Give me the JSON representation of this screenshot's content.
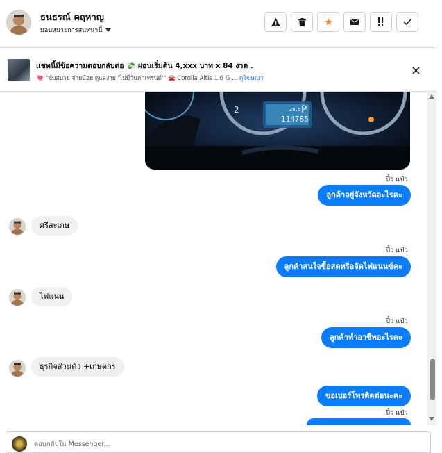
{
  "header": {
    "contact_name": "ธนธรณ์ คฤหาญ",
    "assign_label": "มอบหมายการสนทนานี้",
    "actions": [
      {
        "name": "report-button",
        "icon": "warning-icon"
      },
      {
        "name": "delete-button",
        "icon": "trash-icon"
      },
      {
        "name": "star-button",
        "icon": "star-icon",
        "color": "#f7923a"
      },
      {
        "name": "mark-unread-button",
        "icon": "mail-icon"
      },
      {
        "name": "follow-up-button",
        "icon": "exclamation-icon"
      },
      {
        "name": "done-button",
        "icon": "check-icon"
      }
    ]
  },
  "ad_banner": {
    "title": "แชทนี้มีข้อความตอบกลับต่อ 💸 ผ่อนเริ่มต้น 4,xxx บาท x 84 งวด .",
    "subtitle": "💘 \"ขับสบาย จ่ายน้อย ดูแลง่าย 'ไม่มีวันตกเทรนด์'\" 🚘 Corolla Altis 1.6 G ...",
    "link": "ดูโฆษณา"
  },
  "photo": {
    "odometer": "114785",
    "speedo_number": "2",
    "gear": "P",
    "temp": "28.5"
  },
  "messages": [
    {
      "id": "m1",
      "meta": "ปิ๋ว แป๋ว",
      "text": "ลูกค้าอยู่จังหวัดอะไรคะ"
    },
    {
      "id": "m2",
      "text": "ศรีสะเกษ"
    },
    {
      "id": "m3",
      "meta": "ปิ๋ว แป๋ว",
      "text": "ลูกค้าสนใจซื้อสดหรือจัดไฟแนนซ์คะ"
    },
    {
      "id": "m4",
      "text": "ไฟแนน"
    },
    {
      "id": "m5",
      "meta": "ปิ๋ว แป๋ว",
      "text": "ลูกค้าทำอาชีพอะไรคะ"
    },
    {
      "id": "m6",
      "text": "ธุรกิจส่วนตัว +เกษตกร"
    },
    {
      "id": "m7",
      "text": "ขอเบอร์โทรติดต่อนะคะ"
    },
    {
      "id": "m8",
      "meta": "ปิ๋ว แป๋ว"
    }
  ],
  "composer": {
    "placeholder": "ตอบกลับใน Messenger..."
  },
  "colors": {
    "outgoing_bubble": "#0a7cff",
    "incoming_bubble": "#f0f0f0",
    "link": "#1877f2"
  }
}
